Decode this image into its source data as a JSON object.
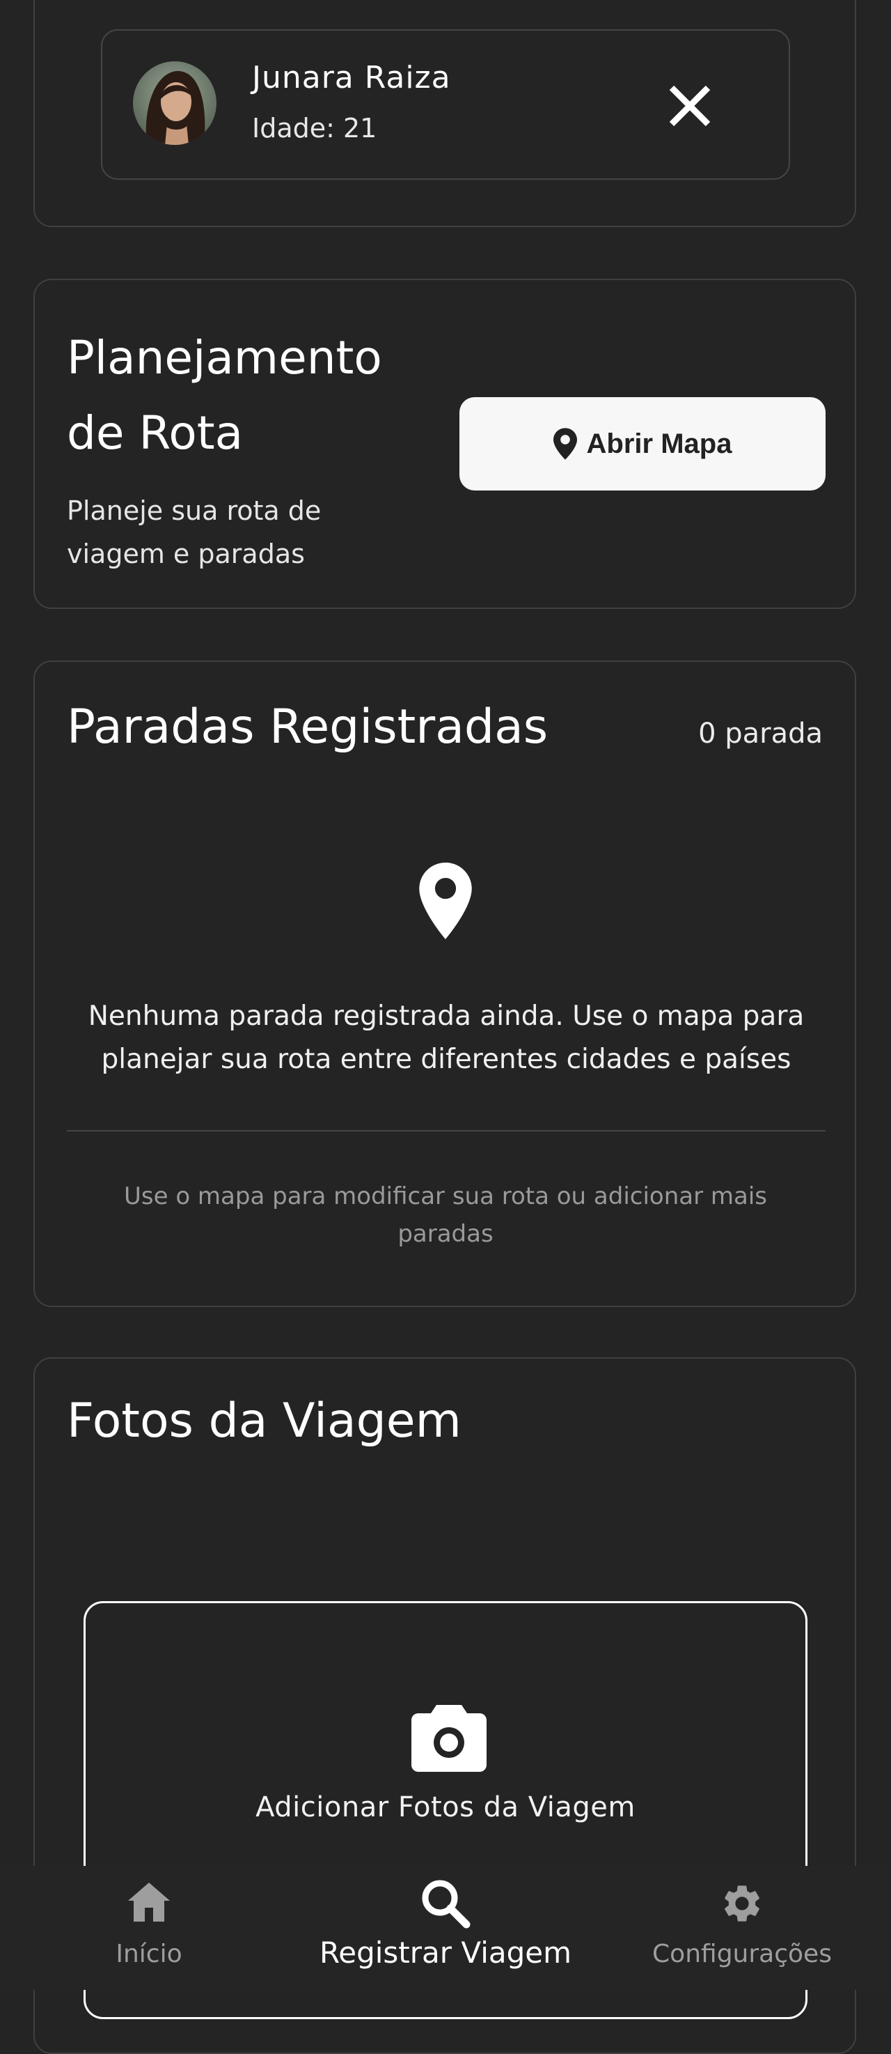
{
  "companion": {
    "name": "Junara Raiza",
    "age": "Idade: 21"
  },
  "route_planning": {
    "title_line1": "Planejamento",
    "title_line2": "de Rota",
    "subtitle_line1": "Planeje sua rota de",
    "subtitle_line2": "viagem e paradas",
    "open_map_label": "Abrir Mapa"
  },
  "stops": {
    "title": "Paradas Registradas",
    "count": "0 parada",
    "empty_line1": "Nenhuma parada registrada ainda. Use o mapa para",
    "empty_line2": "planejar sua rota entre diferentes cidades e países",
    "hint_line1": "Use o mapa para modificar sua rota ou adicionar mais",
    "hint_line2": "paradas"
  },
  "photos": {
    "title": "Fotos da Viagem",
    "add_label": "Adicionar Fotos da Viagem"
  },
  "bottom_nav": {
    "items": [
      {
        "label": "Início",
        "icon": "home-icon",
        "active": false
      },
      {
        "label": "Registrar Viagem",
        "icon": "search-icon",
        "active": true
      },
      {
        "label": "Configurações",
        "icon": "gear-icon",
        "active": false
      }
    ]
  },
  "colors": {
    "background": "#242424",
    "card_border": "#404040",
    "text_primary": "#ffffff",
    "text_muted": "#9e9e9e",
    "button_bg": "#f7f7f7"
  }
}
